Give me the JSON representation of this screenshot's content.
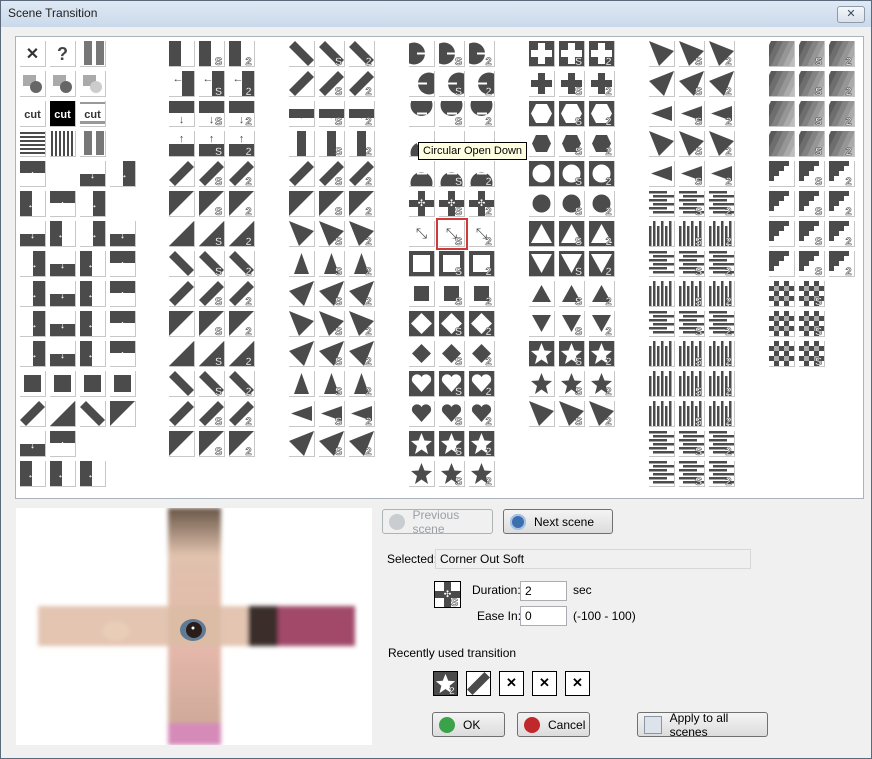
{
  "window": {
    "title": "Scene Transition",
    "close_label": "✕"
  },
  "tooltip": "Circular Open Down",
  "gallery": {
    "columns": [
      {
        "rows": [
          [
            "x",
            "question",
            "noise"
          ],
          [
            "dissolve",
            "dissolve-b",
            "dissolve-c"
          ],
          [
            "cut",
            "cut-inv",
            "cut-bar"
          ],
          [
            "hlines",
            "vlines",
            "noise2"
          ],
          [
            "arrow-down-top",
            "",
            "arrow-left-mid",
            "arrow-right-mid"
          ],
          [
            "arrow-up-bottom",
            "arrow-dl",
            "arrow-ul"
          ],
          [
            "arrow-dr",
            "arrow-ur",
            "arrows-cross",
            "arrows-multi"
          ],
          [
            "half-up",
            "half-right",
            "half-left",
            "half-down"
          ],
          [
            "corner-ne",
            "corner-se",
            "corner-nw",
            "corner-sw"
          ],
          [
            "steps-a",
            "steps-b",
            "steps-c",
            "steps-d"
          ],
          [
            "split-h-in",
            "split-h-out",
            "split-v-in",
            "split-v-out"
          ],
          [
            "bar-right",
            "bar-left",
            "bar-down",
            "bar-up"
          ],
          [
            "diag-nw",
            "diag-ne",
            "diag-se",
            "diag-sw"
          ],
          [
            "slim-h",
            "slim-v"
          ],
          [
            "split-lr",
            "split-tb",
            "rotate"
          ]
        ]
      },
      {
        "rows": [
          [
            "wipe-right",
            "wipe-right-s",
            "wipe-right-2"
          ],
          [
            "wipe-left",
            "wipe-left-s",
            "wipe-left-2"
          ],
          [
            "wipe-down",
            "wipe-down-s",
            "wipe-down-2"
          ],
          [
            "wipe-up",
            "wipe-up-s",
            "wipe-up-2"
          ],
          [
            "diag-a",
            "diag-a-s",
            "diag-a-2"
          ],
          [
            "diag-b",
            "diag-b-s",
            "diag-b-2"
          ],
          [
            "diag-c",
            "diag-c-s",
            "diag-c-2"
          ],
          [
            "diag-d",
            "diag-d-s",
            "diag-d-2"
          ],
          [
            "slide-a",
            "slide-a-s",
            "slide-a-2"
          ],
          [
            "slide-b",
            "slide-b-s",
            "slide-b-2"
          ],
          [
            "slide-c",
            "slide-c-s",
            "slide-c-2"
          ],
          [
            "slide-d",
            "slide-d-s",
            "slide-d-2"
          ],
          [
            "slide-e",
            "slide-e-s",
            "slide-e-2"
          ],
          [
            "slide-f",
            "slide-f-s",
            "slide-f-2"
          ]
        ]
      },
      {
        "rows": [
          [
            "x-a",
            "x-a-s",
            "x-a-2"
          ],
          [
            "x-b",
            "x-b-s",
            "x-b-2"
          ],
          [
            "bar-h",
            "bar-h-s",
            "bar-h-2"
          ],
          [
            "bar-v",
            "bar-v-s",
            "bar-v-2"
          ],
          [
            "band-a",
            "band-a-s",
            "band-a-2"
          ],
          [
            "band-b",
            "band-b-s",
            "band-b-2"
          ],
          [
            "fan-l",
            "fan-l-s",
            "fan-l-2"
          ],
          [
            "fan-r",
            "fan-r-s",
            "fan-r-2"
          ],
          [
            "fan-u",
            "fan-u-s",
            "fan-u-2"
          ],
          [
            "fan-d",
            "fan-d-s",
            "fan-d-2"
          ],
          [
            "fan-a",
            "fan-a-s",
            "fan-a-2"
          ],
          [
            "fan-b",
            "fan-b-s",
            "fan-b-2"
          ],
          [
            "fan-c",
            "fan-c-s",
            "fan-c-2"
          ],
          [
            "fan-e",
            "fan-e-s",
            "fan-e-2"
          ]
        ]
      },
      {
        "rows": [
          [
            "circ-r",
            "circ-r-s",
            "circ-r-2"
          ],
          [
            "circ-l",
            "circ-l-s",
            "circ-l-2"
          ],
          [
            "circ-d",
            "circ-d-s",
            "circ-d-2"
          ],
          [
            "circ-u",
            "circ-u-s",
            "circ-u-2"
          ],
          [
            "circ-u2",
            "circ-u2-s",
            "circ-u2-2"
          ],
          [
            "corner-out",
            "corner-out-s",
            "corner-out-2"
          ],
          [
            "corner-in",
            "corner-in-s",
            "corner-in-2"
          ],
          [
            "box-out",
            "box-out-s",
            "box-out-2"
          ],
          [
            "box-in",
            "box-in-s",
            "box-in-2"
          ],
          [
            "diamond-out",
            "diamond-out-s",
            "diamond-out-2"
          ],
          [
            "diamond-in",
            "diamond-in-s",
            "diamond-in-2"
          ],
          [
            "heart-out",
            "heart-out-s",
            "heart-out-2"
          ],
          [
            "heart-in",
            "heart-in-s",
            "heart-in-2"
          ],
          [
            "star-out",
            "star-out-s",
            "star-out-2"
          ],
          [
            "star-in",
            "star-in-s",
            "star-in-2"
          ]
        ]
      },
      {
        "rows": [
          [
            "plus-out",
            "plus-out-s",
            "plus-out-2"
          ],
          [
            "plus-in",
            "plus-in-s",
            "plus-in-2"
          ],
          [
            "hex-out",
            "hex-out-s",
            "hex-out-2"
          ],
          [
            "hex-in",
            "hex-in-s",
            "hex-in-2"
          ],
          [
            "circle-out",
            "circle-out-s",
            "circle-out-2"
          ],
          [
            "circle-in",
            "circle-in-s",
            "circle-in-2"
          ],
          [
            "tri-up-out",
            "tri-up-out-s",
            "tri-up-out-2"
          ],
          [
            "tri-down-out",
            "tri-down-out-s",
            "tri-down-out-2"
          ],
          [
            "tri-up-in",
            "tri-up-in-s",
            "tri-up-in-2"
          ],
          [
            "tri-down-in",
            "tri-down-in-s",
            "tri-down-in-2"
          ],
          [
            "star5-out",
            "star5-out-s",
            "star5-out-2"
          ],
          [
            "star5-in",
            "star5-in-s",
            "star5-in-2"
          ],
          [
            "tri-arc",
            "tri-arc-s",
            "tri-arc-2"
          ]
        ]
      },
      {
        "rows": [
          [
            "clock-a",
            "clock-a-s",
            "clock-a-2"
          ],
          [
            "clock-b",
            "clock-b-s",
            "clock-b-2"
          ],
          [
            "pin-a",
            "pin-a-s",
            "pin-a-2"
          ],
          [
            "pin-b",
            "pin-b-s",
            "pin-b-2"
          ],
          [
            "rays-a",
            "rays-a-s",
            "rays-a-2"
          ],
          [
            "blinds-h",
            "blinds-h-s",
            "blinds-h-2"
          ],
          [
            "blinds-v",
            "blinds-v-s",
            "blinds-v-2"
          ],
          [
            "blinds-h2",
            "blinds-h2-s",
            "blinds-h2-2"
          ],
          [
            "blinds-v2",
            "blinds-v2-s",
            "blinds-v2-2"
          ],
          [
            "comb-h",
            "comb-h-s",
            "comb-h-2"
          ],
          [
            "comb-v",
            "comb-v-s",
            "comb-v-2"
          ],
          [
            "teeth-a",
            "teeth-a-s",
            "teeth-a-2"
          ],
          [
            "teeth-b",
            "teeth-b-s",
            "teeth-b-2"
          ],
          [
            "stripes-a",
            "stripes-a-s",
            "stripes-a-2"
          ],
          [
            "stripes-b",
            "stripes-b-s",
            "stripes-b-2"
          ]
        ]
      },
      {
        "rows": [
          [
            "grad-a",
            "grad-a-s",
            "grad-a-2"
          ],
          [
            "grad-b",
            "grad-b-s",
            "grad-b-2"
          ],
          [
            "grad-c",
            "grad-c-s",
            "grad-c-2"
          ],
          [
            "grad-d",
            "grad-d-s",
            "grad-d-2"
          ],
          [
            "stair-a",
            "stair-a-s",
            "stair-a-2"
          ],
          [
            "stair-b",
            "stair-b-s",
            "stair-b-2"
          ],
          [
            "stair-c",
            "stair-c-s",
            "stair-c-2"
          ],
          [
            "stair-d",
            "stair-d-s",
            "stair-d-2"
          ],
          [
            "check-a",
            "check-a-s"
          ],
          [
            "check-b",
            "check-b-s"
          ],
          [
            "check-c",
            "check-c-s"
          ]
        ]
      }
    ],
    "selected": {
      "column": 3,
      "row": 6,
      "index": 1
    }
  },
  "nav": {
    "previous_label": "Previous scene",
    "next_label": "Next scene"
  },
  "selected": {
    "label": "Selected:",
    "value": "Corner Out Soft"
  },
  "duration": {
    "label": "Duration:",
    "value": "2",
    "unit": "sec"
  },
  "ease_in": {
    "label": "Ease In:",
    "value": "0",
    "range": "(-100 - 100)"
  },
  "recent": {
    "label": "Recently used transition",
    "items": [
      "star5-out-2",
      "diag-a",
      "empty",
      "empty",
      "empty"
    ],
    "empty_glyph": "✕"
  },
  "actions": {
    "ok_label": "OK",
    "cancel_label": "Cancel",
    "apply_label": "Apply to all scenes"
  },
  "colors": {
    "icon_dark": "#4b4b4b",
    "selection": "#d0393a",
    "tooltip_bg": "#ffffe1"
  }
}
